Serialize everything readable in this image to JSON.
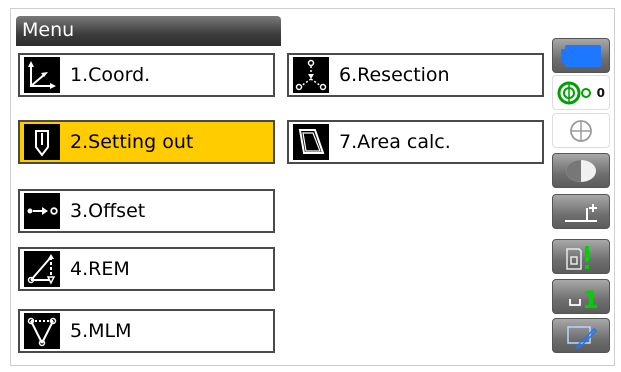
{
  "title": "Menu",
  "menu": [
    {
      "label": "1.Coord.",
      "icon": "coord-axes-icon"
    },
    {
      "label": "2.Setting out",
      "icon": "setting-out-stake-icon",
      "selected": true
    },
    {
      "label": "3.Offset",
      "icon": "offset-arrow-icon"
    },
    {
      "label": "4.REM",
      "icon": "rem-triangle-icon"
    },
    {
      "label": "5.MLM",
      "icon": "mlm-triangle-icon"
    },
    {
      "label": "6.Resection",
      "icon": "resection-icon"
    },
    {
      "label": "7.Area calc.",
      "icon": "area-calc-icon"
    }
  ],
  "side": {
    "battery_icon": "battery-icon",
    "prism_icon": "prism-target-icon",
    "prism_text": "0",
    "tilt_icon": "tilt-crosshair-icon",
    "laser_icon": "laser-pointer-icon",
    "edm_icon": "edm-mode-icon",
    "sd_icon": "sd-card-icon",
    "input_icon": "input-mode-icon",
    "input_text": "1",
    "pen_icon": "pen-tablet-icon"
  },
  "colors": {
    "selected": "#ffcc00",
    "accent_blue": "#1e78ff",
    "accent_green": "#00c000"
  }
}
